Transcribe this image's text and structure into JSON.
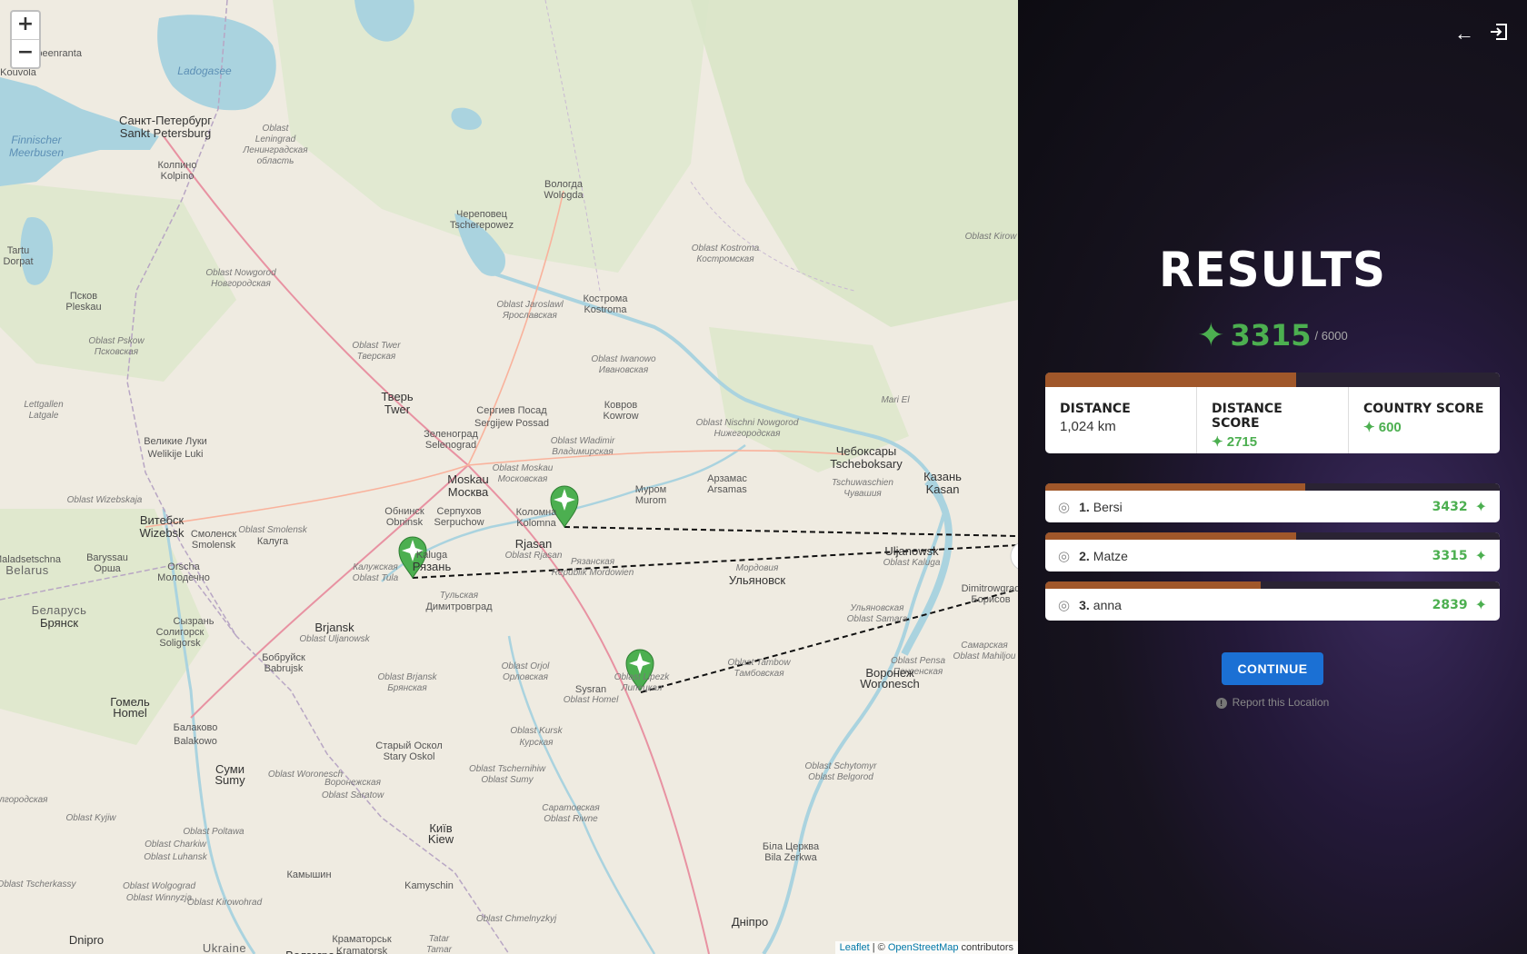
{
  "map": {
    "zoom_in": "+",
    "zoom_out": "−",
    "attribution": {
      "leaflet": "Leaflet",
      "sep": " | © ",
      "osm": "OpenStreetMap",
      "tail": " contributors"
    },
    "labels": [
      {
        "t": "Lappeenranta",
        "k": "city"
      },
      {
        "t": "Ladogasee",
        "k": "water"
      },
      {
        "t": "Kouvola",
        "k": "city"
      },
      {
        "t": "Санкт-Петербург",
        "k": "big"
      },
      {
        "t": "Sankt Petersburg",
        "k": "big"
      },
      {
        "t": "Finnischer",
        "k": "water"
      },
      {
        "t": "Meerbusen",
        "k": "water"
      },
      {
        "t": "Oblast",
        "k": "region"
      },
      {
        "t": "Leningrad",
        "k": "region"
      },
      {
        "t": "Ленинградская",
        "k": "region"
      },
      {
        "t": "область",
        "k": "region"
      },
      {
        "t": "Колпино",
        "k": "city"
      },
      {
        "t": "Kolpino",
        "k": "city"
      },
      {
        "t": "Вологда",
        "k": "city"
      },
      {
        "t": "Wologda",
        "k": "city"
      },
      {
        "t": "Череповец",
        "k": "city"
      },
      {
        "t": "Tscherepowez",
        "k": "city"
      },
      {
        "t": "Tartu",
        "k": "city"
      },
      {
        "t": "Dorpat",
        "k": "city"
      },
      {
        "t": "Oblast Nowgorod",
        "k": "region"
      },
      {
        "t": "Новгородская",
        "k": "region"
      },
      {
        "t": "Псков",
        "k": "city"
      },
      {
        "t": "Pleskau",
        "k": "city"
      },
      {
        "t": "Кострома",
        "k": "city"
      },
      {
        "t": "Kostroma",
        "k": "city"
      },
      {
        "t": "Oblast Kostroma",
        "k": "region"
      },
      {
        "t": "Костромская",
        "k": "region"
      },
      {
        "t": "Oblast Kirow",
        "k": "region"
      },
      {
        "t": "Oblast Pskow",
        "k": "region"
      },
      {
        "t": "Псковская",
        "k": "region"
      },
      {
        "t": "Oblast Twer",
        "k": "region"
      },
      {
        "t": "Тверская",
        "k": "region"
      },
      {
        "t": "Oblast Jaroslawl",
        "k": "region"
      },
      {
        "t": "Ярославская",
        "k": "region"
      },
      {
        "t": "Oblast Iwanowo",
        "k": "region"
      },
      {
        "t": "Ивановская",
        "k": "region"
      },
      {
        "t": "Тверь",
        "k": "big"
      },
      {
        "t": "Twer",
        "k": "big"
      },
      {
        "t": "Сергиев Посад",
        "k": "city"
      },
      {
        "t": "Sergijew Possad",
        "k": "city"
      },
      {
        "t": "Ковров",
        "k": "city"
      },
      {
        "t": "Kowrow",
        "k": "city"
      },
      {
        "t": "Oblast Nischni Nowgorod",
        "k": "region"
      },
      {
        "t": "Нижегородская",
        "k": "region"
      },
      {
        "t": "Mari El",
        "k": "region"
      },
      {
        "t": "Lettgallen",
        "k": "region"
      },
      {
        "t": "Latgale",
        "k": "region"
      },
      {
        "t": "Великие Луки",
        "k": "city"
      },
      {
        "t": "Welikije Luki",
        "k": "city"
      },
      {
        "t": "Зеленоград",
        "k": "city"
      },
      {
        "t": "Selenograd",
        "k": "city"
      },
      {
        "t": "Oblast Wladimir",
        "k": "region"
      },
      {
        "t": "Владимирская",
        "k": "region"
      },
      {
        "t": "Чебоксары",
        "k": "big"
      },
      {
        "t": "Tscheboksary",
        "k": "big"
      },
      {
        "t": "Казань",
        "k": "big"
      },
      {
        "t": "Kasan",
        "k": "big"
      },
      {
        "t": "Moskau",
        "k": "big"
      },
      {
        "t": "Москва",
        "k": "big"
      },
      {
        "t": "Oblast Moskau",
        "k": "region"
      },
      {
        "t": "Московская",
        "k": "region"
      },
      {
        "t": "Арзамас",
        "k": "city"
      },
      {
        "t": "Arsamas",
        "k": "city"
      },
      {
        "t": "Tschuwaschien",
        "k": "region"
      },
      {
        "t": "Чувашия",
        "k": "region"
      },
      {
        "t": "Муром",
        "k": "city"
      },
      {
        "t": "Murom",
        "k": "city"
      },
      {
        "t": "Обнинск",
        "k": "city"
      },
      {
        "t": "Obninsk",
        "k": "city"
      },
      {
        "t": "Серпухов",
        "k": "city"
      },
      {
        "t": "Serpuchow",
        "k": "city"
      },
      {
        "t": "Коломна",
        "k": "city"
      },
      {
        "t": "Kolomna",
        "k": "city"
      },
      {
        "t": "Витебск",
        "k": "big"
      },
      {
        "t": "Wizebsk",
        "k": "big"
      },
      {
        "t": "Oblast Wizebskaja",
        "k": "region"
      },
      {
        "t": "Смоленск",
        "k": "city"
      },
      {
        "t": "Smolensk",
        "k": "city"
      },
      {
        "t": "Oblast Smolensk",
        "k": "region"
      },
      {
        "t": "Калуга",
        "k": "city"
      },
      {
        "t": "Kaluga",
        "k": "city"
      },
      {
        "t": "Рязань",
        "k": "big"
      },
      {
        "t": "Rjasan",
        "k": "big"
      },
      {
        "t": "Oblast Rjasan",
        "k": "region"
      },
      {
        "t": "Рязанская",
        "k": "region"
      },
      {
        "t": "Republik Mordowien",
        "k": "region"
      },
      {
        "t": "Мордовия",
        "k": "region"
      },
      {
        "t": "Ульяновск",
        "k": "big"
      },
      {
        "t": "Uljanowsk",
        "k": "big"
      },
      {
        "t": "Oblast Kaluga",
        "k": "region"
      },
      {
        "t": "Калужская",
        "k": "region"
      },
      {
        "t": "Oblast Tula",
        "k": "region"
      },
      {
        "t": "Тульская",
        "k": "region"
      },
      {
        "t": "Димитровград",
        "k": "city"
      },
      {
        "t": "Dimitrowgrad",
        "k": "city"
      },
      {
        "t": "Борисов",
        "k": "city"
      },
      {
        "t": "Baryssau",
        "k": "city"
      },
      {
        "t": "Орша",
        "k": "city"
      },
      {
        "t": "Orscha",
        "k": "city"
      },
      {
        "t": "Молодечно",
        "k": "city"
      },
      {
        "t": "Maladsetschna",
        "k": "city"
      },
      {
        "t": "Belarus",
        "k": "country"
      },
      {
        "t": "Беларусь",
        "k": "country"
      },
      {
        "t": "Брянск",
        "k": "big"
      },
      {
        "t": "Brjansk",
        "k": "big"
      },
      {
        "t": "Oblast Uljanowsk",
        "k": "region"
      },
      {
        "t": "Ульяновская",
        "k": "region"
      },
      {
        "t": "Oblast Samara",
        "k": "region"
      },
      {
        "t": "Самарская",
        "k": "region"
      },
      {
        "t": "Oblast Mahiljou",
        "k": "region"
      },
      {
        "t": "Солигорск",
        "k": "city"
      },
      {
        "t": "Soligorsk",
        "k": "city"
      },
      {
        "t": "Бобруйск",
        "k": "city"
      },
      {
        "t": "Babrujsk",
        "k": "city"
      },
      {
        "t": "Oblast Brjansk",
        "k": "region"
      },
      {
        "t": "Брянская",
        "k": "region"
      },
      {
        "t": "Oblast Orjol",
        "k": "region"
      },
      {
        "t": "Орловская",
        "k": "region"
      },
      {
        "t": "Oblast Lipezk",
        "k": "region"
      },
      {
        "t": "Липецкая",
        "k": "region"
      },
      {
        "t": "Oblast Tambow",
        "k": "region"
      },
      {
        "t": "Тамбовская",
        "k": "region"
      },
      {
        "t": "Oblast Pensa",
        "k": "region"
      },
      {
        "t": "Пензенская",
        "k": "region"
      },
      {
        "t": "Сызрань",
        "k": "city"
      },
      {
        "t": "Sysran",
        "k": "city"
      },
      {
        "t": "Oblast Homel",
        "k": "region"
      },
      {
        "t": "Гомель",
        "k": "big"
      },
      {
        "t": "Homel",
        "k": "big"
      },
      {
        "t": "Балаково",
        "k": "city"
      },
      {
        "t": "Balakowo",
        "k": "city"
      },
      {
        "t": "Воронеж",
        "k": "big"
      },
      {
        "t": "Woronesch",
        "k": "big"
      },
      {
        "t": "Oblast Kursk",
        "k": "region"
      },
      {
        "t": "Курская",
        "k": "region"
      },
      {
        "t": "Старый Оскол",
        "k": "city"
      },
      {
        "t": "Stary Oskol",
        "k": "city"
      },
      {
        "t": "Oblast Tschernihiw",
        "k": "region"
      },
      {
        "t": "Oblast Sumy",
        "k": "region"
      },
      {
        "t": "Суми",
        "k": "big"
      },
      {
        "t": "Sumy",
        "k": "big"
      },
      {
        "t": "Oblast Woronesch",
        "k": "region"
      },
      {
        "t": "Воронежская",
        "k": "region"
      },
      {
        "t": "Oblast Saratow",
        "k": "region"
      },
      {
        "t": "Саратовская",
        "k": "region"
      },
      {
        "t": "Oblast Riwne",
        "k": "region"
      },
      {
        "t": "Oblast Schytomyr",
        "k": "region"
      },
      {
        "t": "Oblast Belgorod",
        "k": "region"
      },
      {
        "t": "Белгородская",
        "k": "region"
      },
      {
        "t": "Oblast Kyjiw",
        "k": "region"
      },
      {
        "t": "Київ",
        "k": "big"
      },
      {
        "t": "Kiew",
        "k": "big"
      },
      {
        "t": "Oblast Poltawa",
        "k": "region"
      },
      {
        "t": "Oblast Charkiw",
        "k": "region"
      },
      {
        "t": "Oblast Luhansk",
        "k": "region"
      },
      {
        "t": "Камышин",
        "k": "city"
      },
      {
        "t": "Kamyschin",
        "k": "city"
      },
      {
        "t": "Oblast Chmelnyzkyj",
        "k": "region"
      },
      {
        "t": "Біла Церква",
        "k": "city"
      },
      {
        "t": "Bila Zerkwa",
        "k": "city"
      },
      {
        "t": "Oblast Tscherkassy",
        "k": "region"
      },
      {
        "t": "Oblast Wolgograd",
        "k": "region"
      },
      {
        "t": "Oblast Winnyzja",
        "k": "region"
      },
      {
        "t": "Oblast Kirowohrad",
        "k": "region"
      },
      {
        "t": "Дніпро",
        "k": "big"
      },
      {
        "t": "Dnipro",
        "k": "big"
      },
      {
        "t": "Ukraine",
        "k": "country"
      },
      {
        "t": "Краматорськ",
        "k": "city"
      },
      {
        "t": "Kramatorsk",
        "k": "city"
      },
      {
        "t": "Волгоград",
        "k": "big"
      },
      {
        "t": "Tatar",
        "k": "region"
      },
      {
        "t": "Tamar",
        "k": "region"
      }
    ]
  },
  "panel": {
    "title": "RESULTS",
    "total_score": "3315",
    "total_max": "/ 6000",
    "total_fraction": 0.5525,
    "stats": {
      "distance_label": "DISTANCE",
      "distance_value": "1,024 km",
      "distance_score_label": "DISTANCE SCORE",
      "distance_score_value": "2715",
      "country_score_label": "COUNTRY SCORE",
      "country_score_value": "600"
    },
    "leaderboard": [
      {
        "rank": "1.",
        "name": "Bersi",
        "score": "3432",
        "fraction": 0.572
      },
      {
        "rank": "2.",
        "name": "Matze",
        "score": "3315",
        "fraction": 0.5525
      },
      {
        "rank": "3.",
        "name": "anna",
        "score": "2839",
        "fraction": 0.473
      }
    ],
    "continue_label": "CONTINUE",
    "report_label": "Report this Location",
    "colors": {
      "accent_green": "#4caf50",
      "bar_fill": "#a0572a",
      "bar_track": "#2a2333",
      "continue_blue": "#1b70d4"
    },
    "icons": {
      "back": "arrow-left-icon",
      "exit": "exit-icon",
      "star": "star-icon",
      "pin": "target-icon"
    }
  }
}
